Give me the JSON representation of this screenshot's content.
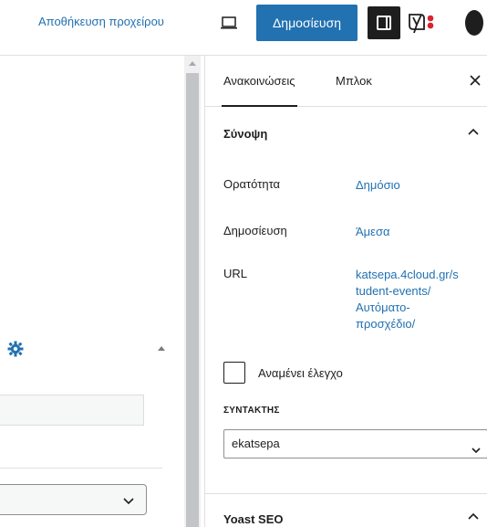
{
  "toolbar": {
    "save_draft": "Αποθήκευση προχείρου",
    "publish": "Δημοσίευση",
    "preview_icon": "desktop-icon",
    "settings_icon": "sidebar-toggle-icon",
    "yoast_icon": "yoast-icon",
    "more_icon": "more-vertical-icon"
  },
  "sidebar": {
    "tabs": [
      {
        "label": "Ανακοινώσεις",
        "active": true
      },
      {
        "label": "Μπλοκ",
        "active": false
      }
    ],
    "summary": {
      "title": "Σύνοψη",
      "rows": [
        {
          "label": "Ορατότητα",
          "value": "Δημόσιο"
        },
        {
          "label": "Δημοσίευση",
          "value": "Άμεσα"
        },
        {
          "label": "URL",
          "value_lines": [
            "katsepa.4cloud.gr/s",
            "tudent-events/",
            "Αυτόματο-",
            "προσχέδιο/"
          ]
        }
      ],
      "pending_review": "Αναμένει έλεγχο",
      "author_label": "ΣΥΝΤΑΚΤΗΣ",
      "author_value": "ekatsepa"
    },
    "yoast": {
      "title": "Yoast SEO"
    }
  },
  "colors": {
    "accent": "#2271b1",
    "dark": "#1e1e1e",
    "yoast_red": "#d9232e"
  }
}
